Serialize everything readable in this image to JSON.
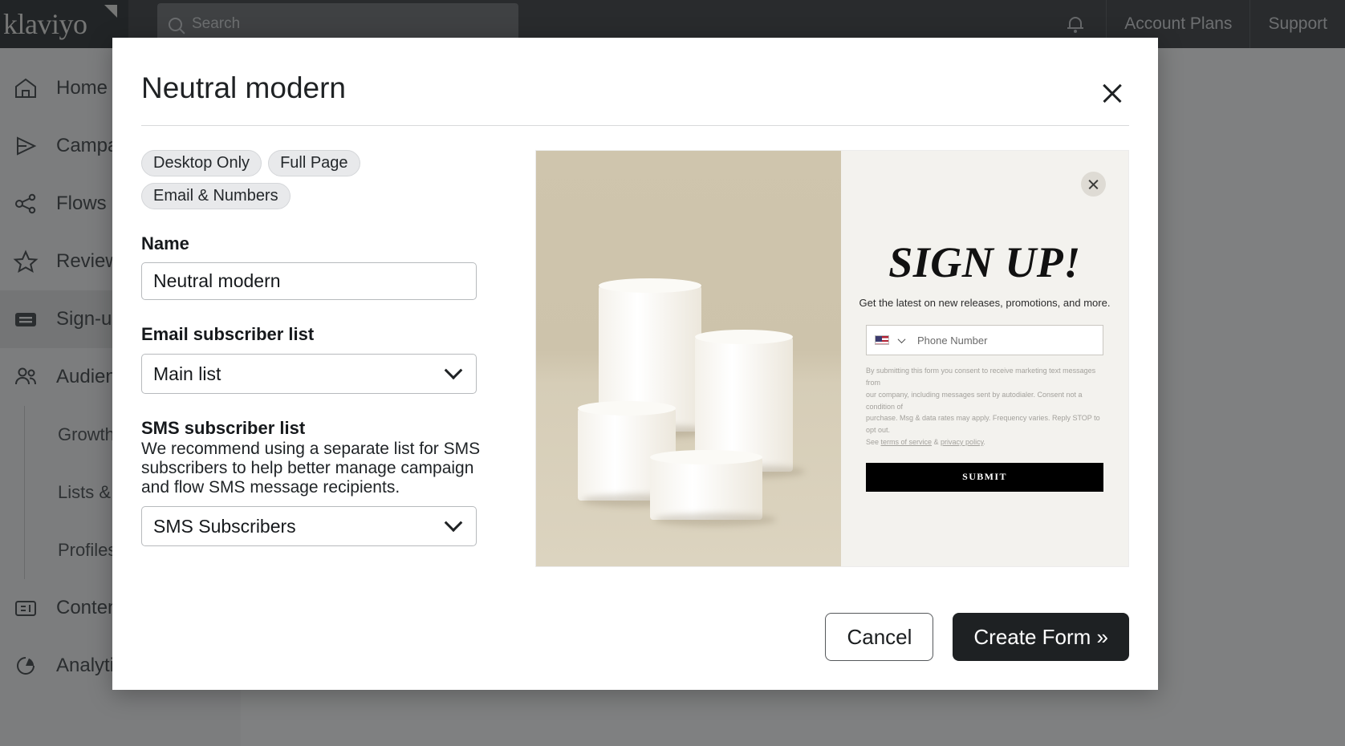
{
  "topbar": {
    "brand": "klaviyo",
    "search_placeholder": "Search",
    "account_plans": "Account Plans",
    "support": "Support"
  },
  "sidebar": {
    "items": [
      {
        "label": "Home",
        "icon": "home-icon",
        "active": false
      },
      {
        "label": "Campaigns",
        "icon": "campaigns-icon",
        "active": false
      },
      {
        "label": "Flows",
        "icon": "flows-icon",
        "active": false
      },
      {
        "label": "Reviews",
        "icon": "star-icon",
        "active": false
      },
      {
        "label": "Sign-up forms",
        "icon": "signup-forms-icon",
        "active": true
      },
      {
        "label": "Audience",
        "icon": "audience-icon",
        "active": false
      }
    ],
    "sub_items": [
      {
        "label": "Growth tools"
      },
      {
        "label": "Lists & segments"
      },
      {
        "label": "Profiles"
      }
    ],
    "lower_items": [
      {
        "label": "Content",
        "icon": "content-icon"
      },
      {
        "label": "Analytics",
        "icon": "analytics-icon"
      }
    ]
  },
  "modal": {
    "title": "Neutral modern",
    "close_icon": "close-icon",
    "tags": [
      "Desktop Only",
      "Full Page",
      "Email & Numbers"
    ],
    "name_field": {
      "label": "Name",
      "value": "Neutral modern"
    },
    "email_list_field": {
      "label": "Email subscriber list",
      "value": "Main list"
    },
    "sms_list_field": {
      "label": "SMS subscriber list",
      "help": "We recommend using a separate list for SMS subscribers to help better manage campaign and flow SMS message recipients.",
      "value": "SMS Subscribers"
    },
    "footer": {
      "cancel_label": "Cancel",
      "create_label": "Create Form »"
    }
  },
  "preview": {
    "close_icon": "close-icon",
    "headline": "SIGN UP!",
    "subheadline": "Get the latest on new releases, promotions, and more.",
    "phone_placeholder": "Phone Number",
    "country_flag": "us-flag-icon",
    "legal_line_1": "By submitting this form you consent to receive marketing text messages from",
    "legal_line_2": "our company, including messages sent by autodialer. Consent not a condition of",
    "legal_line_3": "purchase. Msg & data rates may apply. Frequency varies. Reply STOP to opt out.",
    "legal_line_4_a": "See ",
    "legal_line_4_b": "terms of service",
    "legal_line_4_c": " & ",
    "legal_line_4_d": "privacy policy",
    "legal_line_4_e": ".",
    "submit_label": "SUBMIT"
  },
  "colors": {
    "topbar_bg": "#3b3e40",
    "brand_bg": "#2b2e30",
    "modal_bg": "#ffffff",
    "primary_button": "#1e2123",
    "preview_photo_bg": "#cdc3ab",
    "preview_form_bg": "#f3f2ee"
  }
}
